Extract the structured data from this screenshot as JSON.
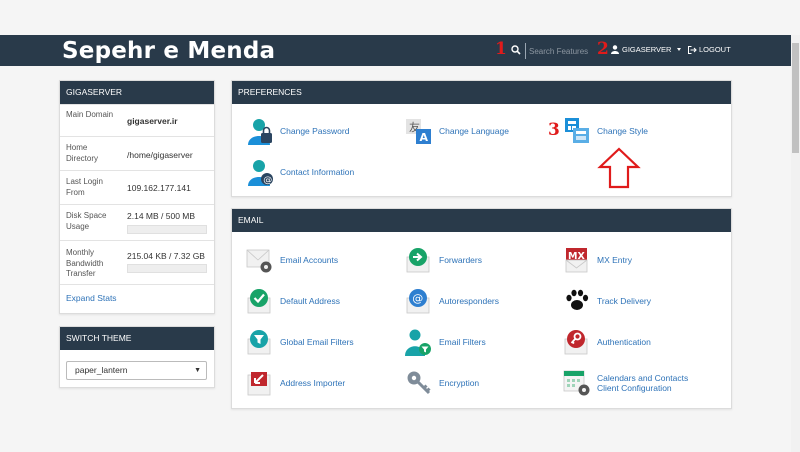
{
  "header": {
    "brand": "Sepehr e Menda",
    "search_placeholder": "Search Features",
    "user_label": "GIGASERVER",
    "logout_label": "LOGOUT",
    "annotations": [
      "1",
      "2",
      "3"
    ]
  },
  "stats": {
    "title": "GIGASERVER",
    "rows": [
      {
        "label": "Main Domain",
        "value": "gigaserver.ir"
      },
      {
        "label": "Home Directory",
        "value": "/home/gigaserver"
      },
      {
        "label": "Last Login From",
        "value": "109.162.177.141"
      },
      {
        "label": "Disk Space Usage",
        "value": "2.14 MB / 500 MB",
        "usage_fraction": 0.004
      },
      {
        "label": "Monthly Bandwidth Transfer",
        "value": "215.04 KB / 7.32 GB",
        "usage_fraction": 0.0
      }
    ],
    "expand_label": "Expand Stats"
  },
  "theme": {
    "title": "SWITCH THEME",
    "selected": "paper_lantern"
  },
  "preferences": {
    "title": "PREFERENCES",
    "items": [
      {
        "label": "Change Password",
        "icon": "change-password-icon"
      },
      {
        "label": "Change Language",
        "icon": "change-language-icon"
      },
      {
        "label": "Change Style",
        "icon": "change-style-icon"
      },
      {
        "label": "Contact Information",
        "icon": "contact-information-icon"
      }
    ]
  },
  "email": {
    "title": "EMAIL",
    "items": [
      {
        "label": "Email Accounts",
        "icon": "email-accounts-icon"
      },
      {
        "label": "Forwarders",
        "icon": "forwarders-icon"
      },
      {
        "label": "MX Entry",
        "icon": "mx-entry-icon"
      },
      {
        "label": "Default Address",
        "icon": "default-address-icon"
      },
      {
        "label": "Autoresponders",
        "icon": "autoresponders-icon"
      },
      {
        "label": "Track Delivery",
        "icon": "track-delivery-icon"
      },
      {
        "label": "Global Email Filters",
        "icon": "global-email-filters-icon"
      },
      {
        "label": "Email Filters",
        "icon": "email-filters-icon"
      },
      {
        "label": "Authentication",
        "icon": "authentication-icon"
      },
      {
        "label": "Address Importer",
        "icon": "address-importer-icon"
      },
      {
        "label": "Encryption",
        "icon": "encryption-icon"
      },
      {
        "label": "Calendars and Contacts Client Configuration",
        "label_lines": [
          "Calendars and Contacts",
          "Client Configuration"
        ],
        "icon": "calendars-contacts-icon"
      }
    ]
  },
  "colors": {
    "navbar": "#293a4a",
    "link": "#2e73b8",
    "annotation": "#e01b1b",
    "accent_blue": "#1b8fd8",
    "accent_green": "#18a368"
  }
}
